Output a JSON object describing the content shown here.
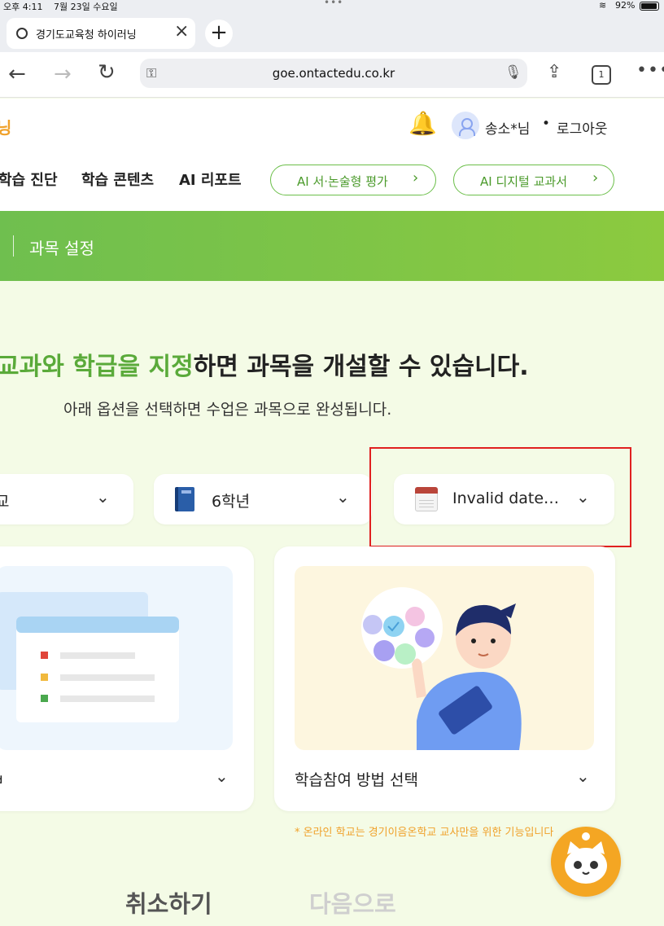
{
  "status_bar": {
    "time": "오후 4:11",
    "date": "7월 23일 수요일",
    "battery": "92%",
    "dots": "•••"
  },
  "browser": {
    "tab_title": "경기도교육청 하이러닝",
    "url": "goe.ontactedu.co.kr",
    "tab_count": "1"
  },
  "header": {
    "brand_fragment": "닝",
    "user_name": "송소*님",
    "separator": "•",
    "logout": "로그아웃",
    "menu": [
      "학습 진단",
      "학습 콘텐츠",
      "AI 리포트"
    ],
    "pills": [
      "AI 서·논술형 평가",
      "AI 디지털 교과서"
    ]
  },
  "banner": {
    "breadcrumb": "과목 설정"
  },
  "main": {
    "headline_green": "교과와 학급을 지정",
    "headline_rest": "하면 과목을 개설할 수 있습니다.",
    "subline": "아래 옵션을 선택하면 수업은 과목으로 완성됩니다.",
    "select_school": "교",
    "select_grade": "6학년",
    "select_date": "Invalid date…",
    "card_left_label": "ㅂ",
    "card_right_label": "학습참여 방법 선택",
    "notice": "* 온라인 학교는 경기이음온학교 교사만을 위한 기능입니다"
  },
  "footer": {
    "cancel": "취소하기",
    "next": "다음으로"
  },
  "colors": {
    "accent_green": "#5aaa3a",
    "banner_green": "#7cc44a",
    "highlight_red": "#e02020",
    "warning_orange": "#f0a12a"
  }
}
